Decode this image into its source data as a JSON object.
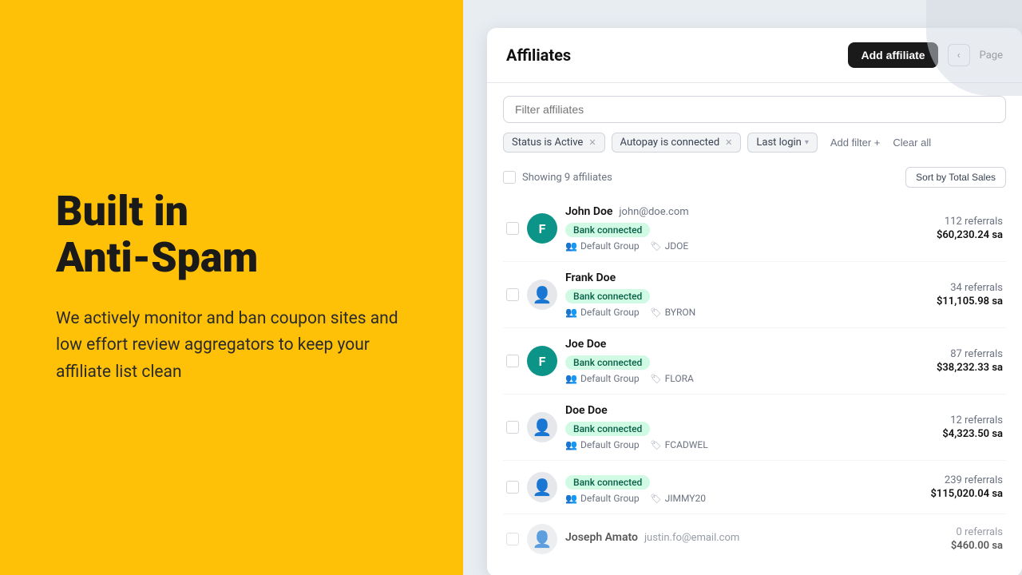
{
  "left": {
    "headline": "Built in\nAnti-Spam",
    "subtext": "We actively monitor and ban coupon sites and low effort review aggregators to keep your affiliate list clean"
  },
  "app": {
    "title": "Affiliates",
    "add_button": "Add affiliate",
    "page_label": "Page",
    "search_placeholder": "Filter affiliates",
    "filters": [
      {
        "id": "status",
        "label": "Status is Active",
        "removable": true
      },
      {
        "id": "autopay",
        "label": "Autopay is connected",
        "removable": true
      },
      {
        "id": "lastlogin",
        "label": "Last login",
        "dropdown": true
      }
    ],
    "add_filter": "Add filter +",
    "clear_all": "Clear all",
    "showing_label": "Showing 9 affiliates",
    "sort_label": "Sort by Total Sales",
    "affiliates": [
      {
        "id": 1,
        "name": "John Doe",
        "email": "john@doe.com",
        "avatar_letter": "F",
        "avatar_type": "teal",
        "bank_connected": true,
        "bank_label": "Bank connected",
        "group": "Default Group",
        "coupon": "JDOE",
        "referrals": "112 referrals",
        "sales": "$60,230.24 sa"
      },
      {
        "id": 2,
        "name": "Frank Doe",
        "email": "",
        "avatar_letter": "",
        "avatar_type": "gray",
        "bank_connected": true,
        "bank_label": "Bank connected",
        "group": "Default Group",
        "coupon": "BYRON",
        "referrals": "34 referrals",
        "sales": "$11,105.98 sa"
      },
      {
        "id": 3,
        "name": "Joe Doe",
        "email": "",
        "avatar_letter": "F",
        "avatar_type": "teal",
        "bank_connected": true,
        "bank_label": "Bank connected",
        "group": "Default Group",
        "coupon": "FLORA",
        "referrals": "87 referrals",
        "sales": "$38,232.33 sa"
      },
      {
        "id": 4,
        "name": "Doe Doe",
        "email": "",
        "avatar_letter": "",
        "avatar_type": "gray",
        "bank_connected": true,
        "bank_label": "Bank connected",
        "group": "Default Group",
        "coupon": "FCADWEL",
        "referrals": "12 referrals",
        "sales": "$4,323.50 sa"
      },
      {
        "id": 5,
        "name": "",
        "email": "",
        "avatar_letter": "",
        "avatar_type": "gray",
        "bank_connected": true,
        "bank_label": "Bank connected",
        "group": "Default Group",
        "coupon": "JIMMY20",
        "referrals": "239 referrals",
        "sales": "$115,020.04 sa"
      }
    ]
  }
}
